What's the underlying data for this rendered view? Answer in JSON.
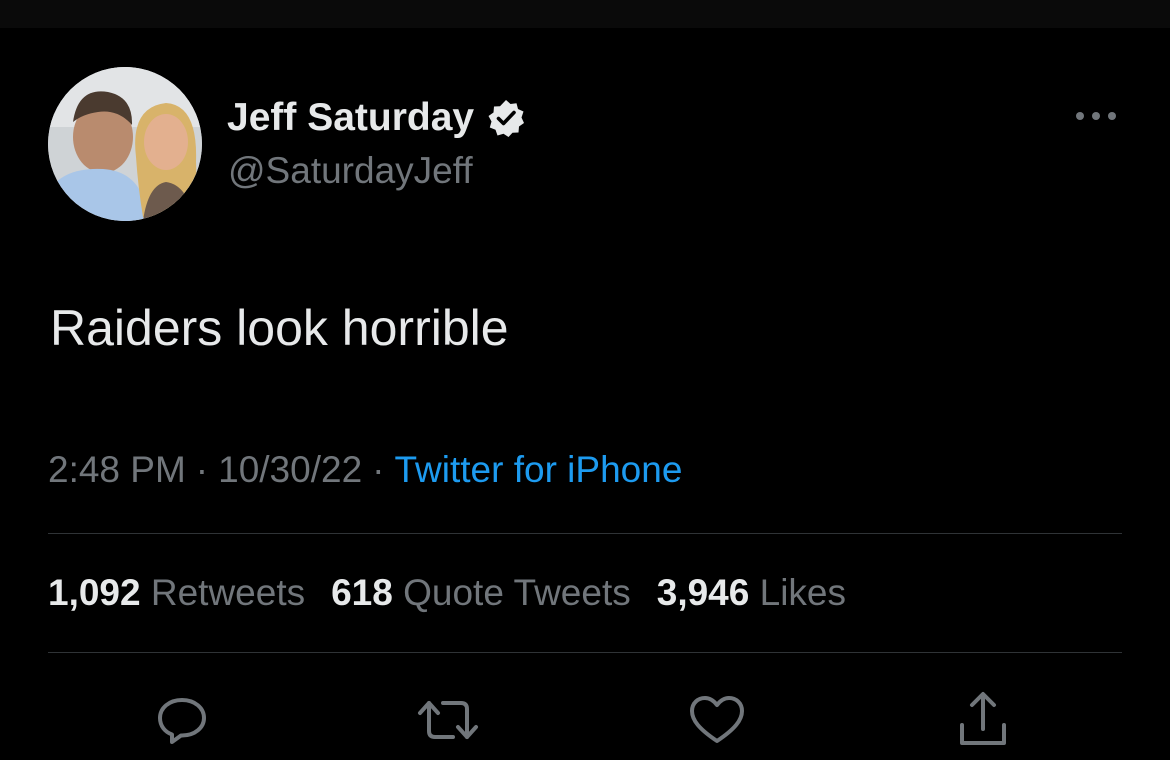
{
  "tweet": {
    "author": {
      "display_name": "Jeff Saturday",
      "handle": "@SaturdayJeff",
      "verified": true
    },
    "text": "Raiders look horrible",
    "time": "2:48 PM",
    "date": "10/30/22",
    "separator": "·",
    "source": "Twitter for iPhone",
    "stats": {
      "retweets_count": "1,092",
      "retweets_label": "Retweets",
      "quotes_count": "618",
      "quotes_label": "Quote Tweets",
      "likes_count": "3,946",
      "likes_label": "Likes"
    }
  },
  "actions": [
    {
      "icon": "reply-icon"
    },
    {
      "icon": "retweet-icon"
    },
    {
      "icon": "like-icon"
    },
    {
      "icon": "share-icon"
    }
  ],
  "colors": {
    "background": "#000000",
    "text_primary": "#e7e9ea",
    "text_secondary": "#71767b",
    "accent": "#1d9bf0",
    "divider": "#2f3336"
  }
}
